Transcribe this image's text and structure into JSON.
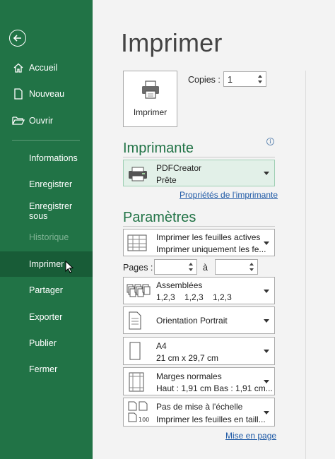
{
  "sidebar": {
    "items": [
      {
        "label": "Accueil"
      },
      {
        "label": "Nouveau"
      },
      {
        "label": "Ouvrir"
      },
      {
        "label": "Informations"
      },
      {
        "label": "Enregistrer"
      },
      {
        "label": "Enregistrer sous"
      },
      {
        "label": "Historique"
      },
      {
        "label": "Imprimer"
      },
      {
        "label": "Partager"
      },
      {
        "label": "Exporter"
      },
      {
        "label": "Publier"
      },
      {
        "label": "Fermer"
      }
    ]
  },
  "main": {
    "title": "Imprimer",
    "print_button": "Imprimer",
    "copies_label": "Copies :",
    "copies_value": "1",
    "printer_section": "Imprimante",
    "printer_name": "PDFCreator",
    "printer_status": "Prête",
    "printer_properties_link": "Propriétés de l'imprimante",
    "settings_section": "Paramètres",
    "print_what_l1": "Imprimer les feuilles actives",
    "print_what_l2": "Imprimer uniquement les fe...",
    "pages_label": "Pages :",
    "pages_to_label": "à",
    "collate_l1": "Assemblées",
    "collate_l2": "1,2,3    1,2,3    1,2,3",
    "orientation": "Orientation Portrait",
    "paper_l1": "A4",
    "paper_l2": "21 cm x 29,7 cm",
    "margins_l1": "Marges normales",
    "margins_l2": "Haut : 1,91 cm Bas : 1,91 cm...",
    "scaling_l1": "Pas de mise à l'échelle",
    "scaling_l2": "Imprimer les feuilles en taill...",
    "scaling_icon_text": "100",
    "page_setup_link": "Mise en page"
  },
  "colors": {
    "sidebar_bg": "#217346",
    "sidebar_active": "#185c37",
    "accent": "#217346",
    "link": "#1f5aa6"
  }
}
